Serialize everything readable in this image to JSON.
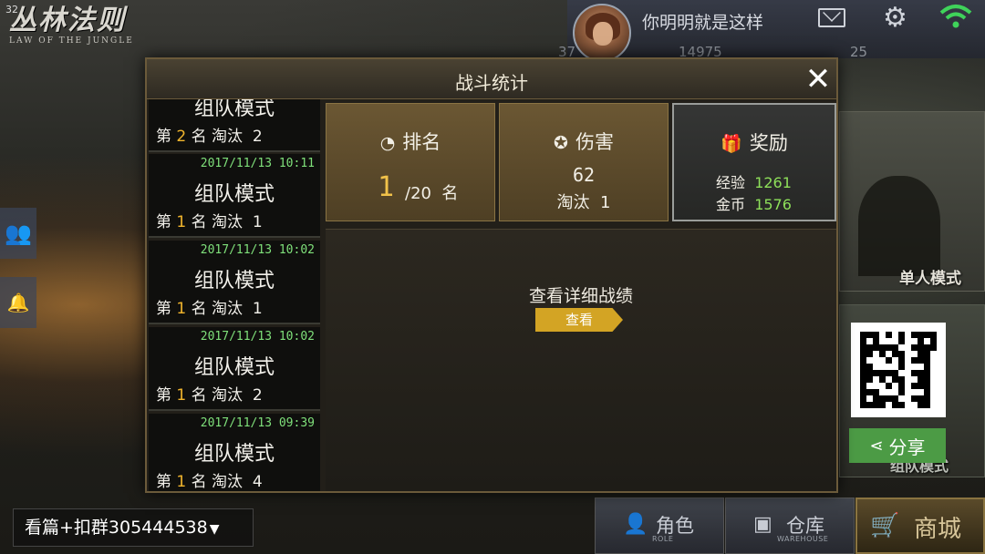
{
  "status": {
    "num": "32"
  },
  "logo": {
    "title": "丛林法则",
    "subtitle": "LAW OF THE JUNGLE"
  },
  "topbar": {
    "username": "你明明就是这样",
    "partial_left": "37",
    "coins": "14975",
    "gems": "25"
  },
  "dialog": {
    "title": "战斗统计",
    "close": "✕"
  },
  "matches": [
    {
      "date": "",
      "mode": "组队模式",
      "rank_prefix": "第 ",
      "rank": "2",
      "rank_suffix": " 名 淘汰  2"
    },
    {
      "date": "2017/11/13 10:11",
      "mode": "组队模式",
      "rank_prefix": "第 ",
      "rank": "1",
      "rank_suffix": " 名 淘汰  1"
    },
    {
      "date": "2017/11/13 10:02",
      "mode": "组队模式",
      "rank_prefix": "第 ",
      "rank": "1",
      "rank_suffix": " 名 淘汰  1"
    },
    {
      "date": "2017/11/13 10:02",
      "mode": "组队模式",
      "rank_prefix": "第 ",
      "rank": "1",
      "rank_suffix": " 名 淘汰  2"
    },
    {
      "date": "2017/11/13 09:39",
      "mode": "组队模式",
      "rank_prefix": "第 ",
      "rank": "1",
      "rank_suffix": " 名 淘汰  4"
    }
  ],
  "stats": {
    "rank": {
      "label": "排名",
      "value": "1",
      "rest": "/20  名"
    },
    "damage": {
      "label": "伤害",
      "value": "62",
      "kills": "淘汰  1"
    },
    "reward": {
      "label": "奖励",
      "exp_label": "经验  ",
      "exp": "1261",
      "gold_label": "金币  ",
      "gold": "1576"
    }
  },
  "detail": {
    "text": "查看详细战绩",
    "button": "查看"
  },
  "right": {
    "solo_mode": "单人模式",
    "team_mode": "组队模式",
    "share": "分享"
  },
  "bottom": {
    "input_text": "看篇+扣群305444538",
    "caret": "▼",
    "role_label": "角色",
    "role_sub": "ROLE",
    "warehouse_label": "仓库",
    "warehouse_sub": "WAREHOUSE",
    "shop_label": "商城"
  },
  "colors": {
    "accent_gold": "#f1b52d",
    "green": "#7fe07a",
    "share_green": "#4c9b45"
  },
  "icons": [
    "mail-icon",
    "gear-icon",
    "wifi-icon",
    "close-icon",
    "rank-icon",
    "medal-icon",
    "gift-icon",
    "share-icon",
    "friends-icon",
    "alert-icon",
    "role-icon",
    "warehouse-icon",
    "cart-icon"
  ]
}
